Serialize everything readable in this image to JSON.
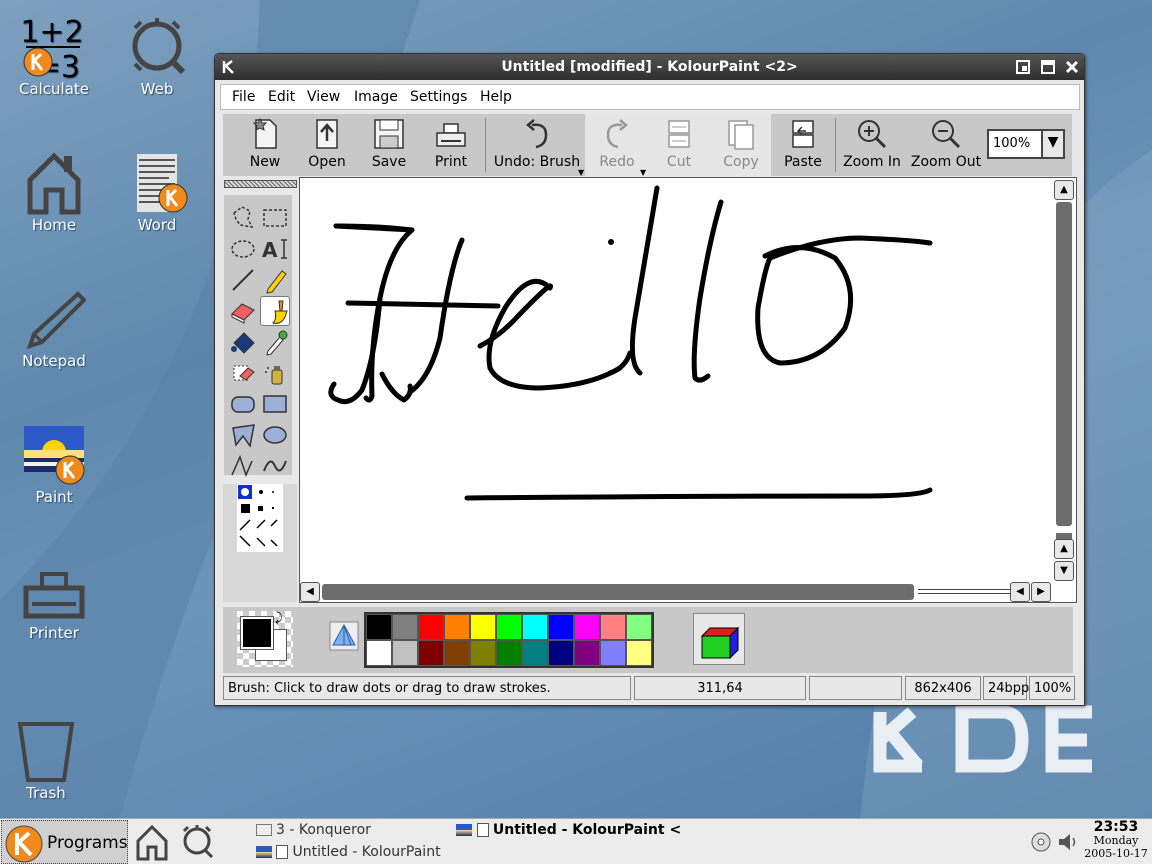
{
  "desktop": {
    "icons": [
      {
        "label": "Calculate",
        "icon": "calculator-icon"
      },
      {
        "label": "Web",
        "icon": "web-browser-icon"
      },
      {
        "label": "Home",
        "icon": "home-icon"
      },
      {
        "label": "Word",
        "icon": "word-processor-icon"
      },
      {
        "label": "Notepad",
        "icon": "notepad-icon"
      },
      {
        "label": "Paint",
        "icon": "paint-icon"
      },
      {
        "label": "Printer",
        "icon": "printer-icon"
      },
      {
        "label": "Trash",
        "icon": "trash-icon"
      }
    ],
    "calc_glyph": {
      "top": "1+2",
      "bottom": "=3"
    }
  },
  "window": {
    "title": "Untitled [modified] - KolourPaint <2>",
    "menu": [
      "File",
      "Edit",
      "View",
      "Image",
      "Settings",
      "Help"
    ],
    "toolbar": {
      "new": "New",
      "open": "Open",
      "save": "Save",
      "print": "Print",
      "undo": "Undo: Brush",
      "redo": "Redo",
      "cut": "Cut",
      "copy": "Copy",
      "paste": "Paste",
      "zoom_in": "Zoom In",
      "zoom_out": "Zoom Out",
      "zoom_value": "100%"
    },
    "tools": [
      "free-form-selection-icon",
      "rectangular-selection-icon",
      "elliptical-selection-icon",
      "text-tool-icon",
      "line-tool-icon",
      "pen-tool-icon",
      "eraser-tool-icon",
      "brush-tool-icon",
      "flood-fill-icon",
      "color-picker-icon",
      "color-eraser-icon",
      "spraycan-icon",
      "rounded-rectangle-icon",
      "rectangle-tool-icon",
      "polygon-tool-icon",
      "ellipse-tool-icon",
      "connected-lines-icon",
      "curve-tool-icon"
    ],
    "selected_tool": "brush-tool-icon",
    "palette": {
      "top": [
        "#000000",
        "#808080",
        "#ff0000",
        "#ff8000",
        "#ffff00",
        "#00ff00",
        "#00ffff",
        "#0000ff",
        "#ff00ff",
        "#ff8080",
        "#80ff80"
      ],
      "bottom": [
        "#ffffff",
        "#c0c0c0",
        "#800000",
        "#804000",
        "#808000",
        "#008000",
        "#008080",
        "#000080",
        "#800080",
        "#8080ff",
        "#ffff80"
      ]
    },
    "foreground_color": "#000000",
    "background_color": "#ffffff",
    "status": {
      "message": "Brush: Click to draw dots or drag to draw strokes.",
      "coords": "311,64",
      "selection": "",
      "size": "862x406",
      "depth": "24bpp",
      "zoom": "100%"
    }
  },
  "taskbar": {
    "programs_label": "Programs",
    "tasks": [
      "3 - Konqueror",
      "Untitled - KolourPaint",
      "Untitled - KolourPaint <"
    ],
    "clock": {
      "time": "23:53",
      "day": "Monday",
      "date": "2005-10-17"
    }
  }
}
